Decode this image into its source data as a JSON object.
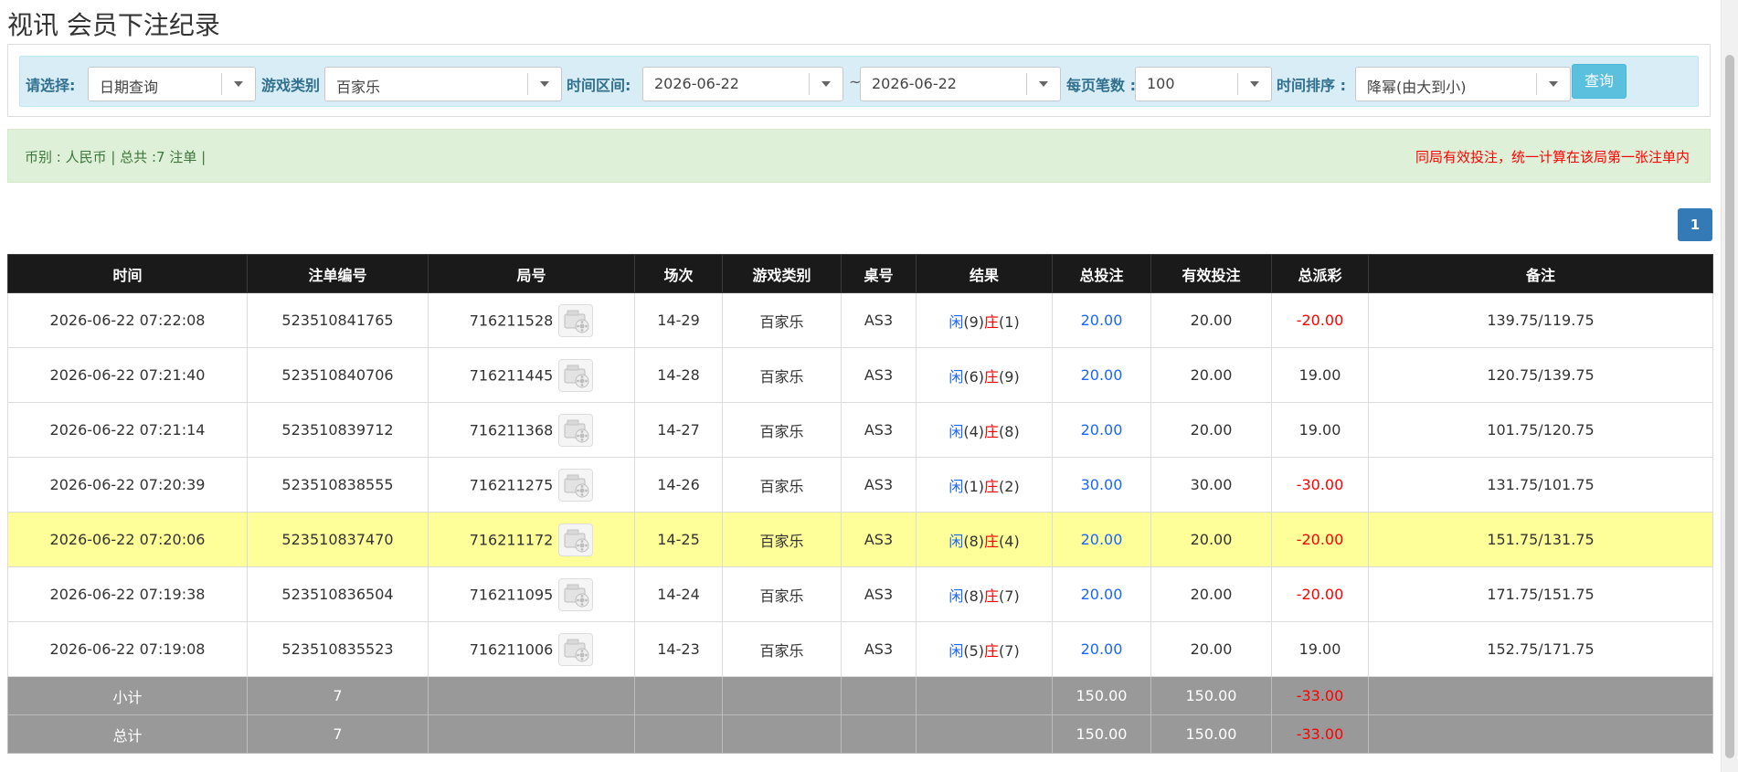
{
  "page": {
    "title": "视讯 会员下注纪录"
  },
  "filters": {
    "select_label": "请选择:",
    "select_value": "日期查询",
    "game_type_label": "游戏类别",
    "game_type_value": "百家乐",
    "time_range_label": "时间区间:",
    "date_from": "2026-06-22",
    "tilde": "~",
    "date_to": "2026-06-22",
    "per_page_label": "每页笔数 :",
    "per_page_value": "100",
    "sort_label": "时间排序 :",
    "sort_value": "降幂(由大到小)",
    "query_button": "查询"
  },
  "info": {
    "summary": "币别 : 人民币 | 总共 :7 注单 |",
    "notice": "同局有效投注，统一计算在该局第一张注单内"
  },
  "pagination": {
    "current_page": "1"
  },
  "table": {
    "headers": [
      "时间",
      "注单编号",
      "局号",
      "场次",
      "游戏类别",
      "桌号",
      "结果",
      "总投注",
      "有效投注",
      "总派彩",
      "备注"
    ],
    "rows": [
      {
        "time": "2026-06-22 07:22:08",
        "order_no": "523510841765",
        "round_no": "716211528",
        "session": "14-29",
        "game": "百家乐",
        "table": "AS3",
        "player": "闲",
        "player_pts": "(9)",
        "banker": "庄",
        "banker_pts": "(1)",
        "total_bet": "20.00",
        "valid_bet": "20.00",
        "payout": "-20.00",
        "payout_negative": true,
        "note": "139.75/119.75",
        "highlight": false
      },
      {
        "time": "2026-06-22 07:21:40",
        "order_no": "523510840706",
        "round_no": "716211445",
        "session": "14-28",
        "game": "百家乐",
        "table": "AS3",
        "player": "闲",
        "player_pts": "(6)",
        "banker": "庄",
        "banker_pts": "(9)",
        "total_bet": "20.00",
        "valid_bet": "20.00",
        "payout": "19.00",
        "payout_negative": false,
        "note": "120.75/139.75",
        "highlight": false
      },
      {
        "time": "2026-06-22 07:21:14",
        "order_no": "523510839712",
        "round_no": "716211368",
        "session": "14-27",
        "game": "百家乐",
        "table": "AS3",
        "player": "闲",
        "player_pts": "(4)",
        "banker": "庄",
        "banker_pts": "(8)",
        "total_bet": "20.00",
        "valid_bet": "20.00",
        "payout": "19.00",
        "payout_negative": false,
        "note": "101.75/120.75",
        "highlight": false
      },
      {
        "time": "2026-06-22 07:20:39",
        "order_no": "523510838555",
        "round_no": "716211275",
        "session": "14-26",
        "game": "百家乐",
        "table": "AS3",
        "player": "闲",
        "player_pts": "(1)",
        "banker": "庄",
        "banker_pts": "(2)",
        "total_bet": "30.00",
        "valid_bet": "30.00",
        "payout": "-30.00",
        "payout_negative": true,
        "note": "131.75/101.75",
        "highlight": false
      },
      {
        "time": "2026-06-22 07:20:06",
        "order_no": "523510837470",
        "round_no": "716211172",
        "session": "14-25",
        "game": "百家乐",
        "table": "AS3",
        "player": "闲",
        "player_pts": "(8)",
        "banker": "庄",
        "banker_pts": "(4)",
        "total_bet": "20.00",
        "valid_bet": "20.00",
        "payout": "-20.00",
        "payout_negative": true,
        "note": "151.75/131.75",
        "highlight": true
      },
      {
        "time": "2026-06-22 07:19:38",
        "order_no": "523510836504",
        "round_no": "716211095",
        "session": "14-24",
        "game": "百家乐",
        "table": "AS3",
        "player": "闲",
        "player_pts": "(8)",
        "banker": "庄",
        "banker_pts": "(7)",
        "total_bet": "20.00",
        "valid_bet": "20.00",
        "payout": "-20.00",
        "payout_negative": true,
        "note": "171.75/151.75",
        "highlight": false
      },
      {
        "time": "2026-06-22 07:19:08",
        "order_no": "523510835523",
        "round_no": "716211006",
        "session": "14-23",
        "game": "百家乐",
        "table": "AS3",
        "player": "闲",
        "player_pts": "(5)",
        "banker": "庄",
        "banker_pts": "(7)",
        "total_bet": "20.00",
        "valid_bet": "20.00",
        "payout": "19.00",
        "payout_negative": false,
        "note": "152.75/171.75",
        "highlight": false
      }
    ],
    "subtotal": {
      "label": "小计",
      "count": "7",
      "total_bet": "150.00",
      "valid_bet": "150.00",
      "payout": "-33.00"
    },
    "total": {
      "label": "总计",
      "count": "7",
      "total_bet": "150.00",
      "valid_bet": "150.00",
      "payout": "-33.00"
    }
  },
  "colors": {
    "header_bg": "#1a1a1a",
    "filter_bg": "#d9edf7",
    "info_bg": "#dff0d8",
    "highlight_row": "#ffff99",
    "summary_bg": "#999999",
    "query_button": "#5bc0de",
    "pager": "#337ab7",
    "player_blue": "#1a66ff",
    "banker_red": "#ff0000"
  },
  "icons": {
    "replay": "video-replay-icon",
    "dropdown": "caret-down-icon"
  }
}
